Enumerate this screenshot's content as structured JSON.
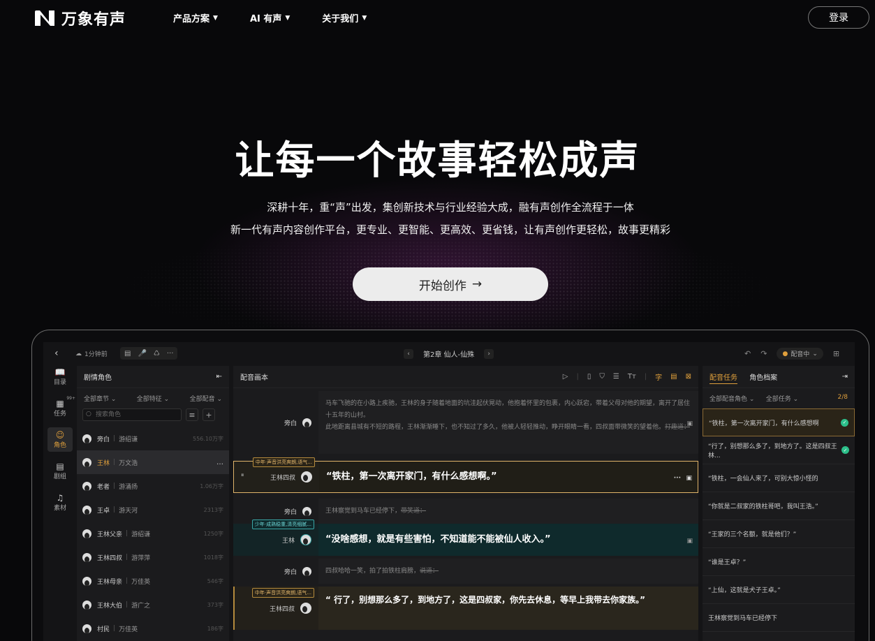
{
  "nav": {
    "brand": "万象有声",
    "menu": [
      "产品方案",
      "AI 有声",
      "关于我们"
    ],
    "caret": "▼",
    "login": "登录"
  },
  "hero": {
    "title": "让每一个故事轻松成声",
    "subtitle_1": "深耕十年，重“声”出发，集创新技术与行业经验大成，融有声创作全流程于一体",
    "subtitle_2": "新一代有声内容创作平台，更专业、更智能、更高效、更省钱，让有声创作更轻松，故事更精彩",
    "cta": "开始创作",
    "cta_arrow": "→"
  },
  "app": {
    "topbar": {
      "duration": "1分钟前",
      "chapter": "第2章  仙人-仙殊",
      "status": "配音中"
    },
    "rail": [
      {
        "icon": "📖",
        "label": "目录"
      },
      {
        "icon": "▦",
        "label": "任务",
        "badge": "99+"
      },
      {
        "icon": "☺",
        "label": "角色",
        "active": true
      },
      {
        "icon": "▤",
        "label": "剧组"
      },
      {
        "icon": "♫",
        "label": "素材"
      }
    ],
    "roles_panel": {
      "title": "剧情角色",
      "filters": [
        "全部章节",
        "全部特征",
        "全部配音"
      ],
      "search_placeholder": "搜索角色",
      "roles": [
        {
          "name": "旁白",
          "voice": "游绍谦",
          "count": "556.10万字"
        },
        {
          "name": "王林",
          "voice": "万文浩",
          "count": "…"
        },
        {
          "name": "老者",
          "voice": "游涌扬",
          "count": "1.06万字"
        },
        {
          "name": "王卓",
          "voice": "游天河",
          "count": "2313字"
        },
        {
          "name": "王林父亲",
          "voice": "游绍谦",
          "count": "1250字"
        },
        {
          "name": "王林四叔",
          "voice": "游萍萍",
          "count": "1018字"
        },
        {
          "name": "王林母亲",
          "voice": "万佳英",
          "count": "546字"
        },
        {
          "name": "王林大伯",
          "voice": "游广之",
          "count": "373字"
        },
        {
          "name": "村民",
          "voice": "万佳英",
          "count": "186字"
        }
      ]
    },
    "script_panel": {
      "title": "配音画本",
      "lines": [
        {
          "speaker": "旁白",
          "text_1": "马车飞驰的在小路上疾驰，王林的身子随着地面的坑洼起伏晃动，他抱着怀里的包裹，内心跃宕，带着父母对他的期望，离开了居住十五年的山村。",
          "text_2": "此地距离县城有不短的路程，王林渐渐睡下，也不知过了多久，他被人轻轻推动，睁开眼睛一看，四叔面带微笑的望着他。",
          "strike": "打趣道："
        },
        {
          "speaker": "王林四叔",
          "tag": "中年·声音洪亮爽朗,语气...",
          "text": "“铁柱，第一次离开家门，有什么感想啊。”"
        },
        {
          "speaker": "旁白",
          "text": "王林察觉到马车已经停下，",
          "strike": "带笑道："
        },
        {
          "speaker": "王林",
          "tag": "少年·成熟稳重,清亮细腻...",
          "text": "“没啥感想，就是有些害怕，不知道能不能被仙人收入。”"
        },
        {
          "speaker": "旁白",
          "text": "四叔哈哈一笑，拍了拍铁柱肩膀，",
          "strike": "说道："
        },
        {
          "speaker": "王林四叔",
          "tag": "中年·声音洪亮爽朗,语气...",
          "text": "“ 行了，别想那么多了，到地方了，这是四叔家，你先去休息，等早上我带去你家族。”"
        }
      ]
    },
    "tasks_panel": {
      "tabs": [
        "配音任务",
        "角色档案"
      ],
      "filters": [
        "全部配音角色",
        "全部任务"
      ],
      "progress": "2/8",
      "tasks": [
        {
          "text": "“铁柱，第一次离开家门，有什么感想啊",
          "done": true
        },
        {
          "text": "“行了，别想那么多了，到地方了。这是四叔王林...",
          "done": true
        },
        {
          "text": "“铁柱，一会仙人来了，可别大惊小怪的",
          "done": false
        },
        {
          "text": "“你就是二叔家的铁柱哥吧，我叫王浩。”",
          "done": false
        },
        {
          "text": "“王家的三个名额，就是他们？”",
          "done": false
        },
        {
          "text": "“谁是王卓？”",
          "done": false
        },
        {
          "text": "“上仙，这就是犬子王卓。”",
          "done": false
        },
        {
          "text": "王林察觉到马车已经停下",
          "done": false
        }
      ]
    }
  }
}
